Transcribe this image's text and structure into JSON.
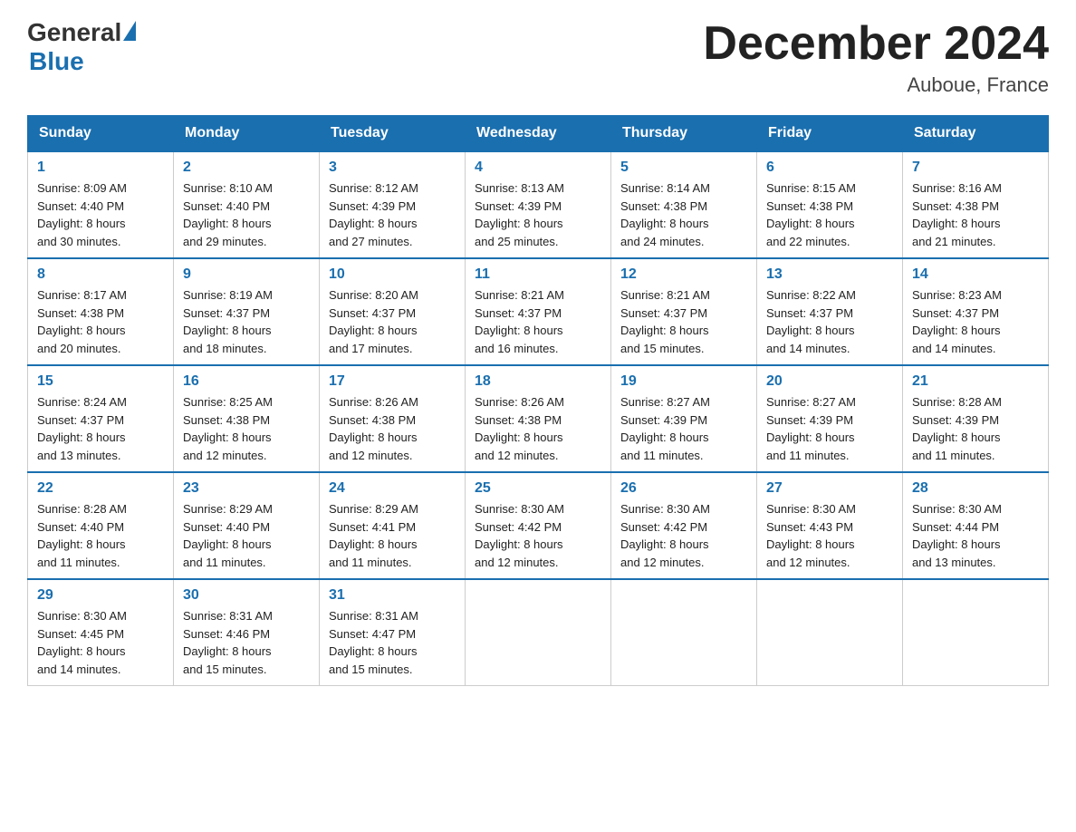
{
  "header": {
    "logo_general": "General",
    "logo_blue": "Blue",
    "month_title": "December 2024",
    "location": "Auboue, France"
  },
  "days_of_week": [
    "Sunday",
    "Monday",
    "Tuesday",
    "Wednesday",
    "Thursday",
    "Friday",
    "Saturday"
  ],
  "weeks": [
    [
      {
        "day": "1",
        "sunrise": "8:09 AM",
        "sunset": "4:40 PM",
        "daylight": "8 hours and 30 minutes."
      },
      {
        "day": "2",
        "sunrise": "8:10 AM",
        "sunset": "4:40 PM",
        "daylight": "8 hours and 29 minutes."
      },
      {
        "day": "3",
        "sunrise": "8:12 AM",
        "sunset": "4:39 PM",
        "daylight": "8 hours and 27 minutes."
      },
      {
        "day": "4",
        "sunrise": "8:13 AM",
        "sunset": "4:39 PM",
        "daylight": "8 hours and 25 minutes."
      },
      {
        "day": "5",
        "sunrise": "8:14 AM",
        "sunset": "4:38 PM",
        "daylight": "8 hours and 24 minutes."
      },
      {
        "day": "6",
        "sunrise": "8:15 AM",
        "sunset": "4:38 PM",
        "daylight": "8 hours and 22 minutes."
      },
      {
        "day": "7",
        "sunrise": "8:16 AM",
        "sunset": "4:38 PM",
        "daylight": "8 hours and 21 minutes."
      }
    ],
    [
      {
        "day": "8",
        "sunrise": "8:17 AM",
        "sunset": "4:38 PM",
        "daylight": "8 hours and 20 minutes."
      },
      {
        "day": "9",
        "sunrise": "8:19 AM",
        "sunset": "4:37 PM",
        "daylight": "8 hours and 18 minutes."
      },
      {
        "day": "10",
        "sunrise": "8:20 AM",
        "sunset": "4:37 PM",
        "daylight": "8 hours and 17 minutes."
      },
      {
        "day": "11",
        "sunrise": "8:21 AM",
        "sunset": "4:37 PM",
        "daylight": "8 hours and 16 minutes."
      },
      {
        "day": "12",
        "sunrise": "8:21 AM",
        "sunset": "4:37 PM",
        "daylight": "8 hours and 15 minutes."
      },
      {
        "day": "13",
        "sunrise": "8:22 AM",
        "sunset": "4:37 PM",
        "daylight": "8 hours and 14 minutes."
      },
      {
        "day": "14",
        "sunrise": "8:23 AM",
        "sunset": "4:37 PM",
        "daylight": "8 hours and 14 minutes."
      }
    ],
    [
      {
        "day": "15",
        "sunrise": "8:24 AM",
        "sunset": "4:37 PM",
        "daylight": "8 hours and 13 minutes."
      },
      {
        "day": "16",
        "sunrise": "8:25 AM",
        "sunset": "4:38 PM",
        "daylight": "8 hours and 12 minutes."
      },
      {
        "day": "17",
        "sunrise": "8:26 AM",
        "sunset": "4:38 PM",
        "daylight": "8 hours and 12 minutes."
      },
      {
        "day": "18",
        "sunrise": "8:26 AM",
        "sunset": "4:38 PM",
        "daylight": "8 hours and 12 minutes."
      },
      {
        "day": "19",
        "sunrise": "8:27 AM",
        "sunset": "4:39 PM",
        "daylight": "8 hours and 11 minutes."
      },
      {
        "day": "20",
        "sunrise": "8:27 AM",
        "sunset": "4:39 PM",
        "daylight": "8 hours and 11 minutes."
      },
      {
        "day": "21",
        "sunrise": "8:28 AM",
        "sunset": "4:39 PM",
        "daylight": "8 hours and 11 minutes."
      }
    ],
    [
      {
        "day": "22",
        "sunrise": "8:28 AM",
        "sunset": "4:40 PM",
        "daylight": "8 hours and 11 minutes."
      },
      {
        "day": "23",
        "sunrise": "8:29 AM",
        "sunset": "4:40 PM",
        "daylight": "8 hours and 11 minutes."
      },
      {
        "day": "24",
        "sunrise": "8:29 AM",
        "sunset": "4:41 PM",
        "daylight": "8 hours and 11 minutes."
      },
      {
        "day": "25",
        "sunrise": "8:30 AM",
        "sunset": "4:42 PM",
        "daylight": "8 hours and 12 minutes."
      },
      {
        "day": "26",
        "sunrise": "8:30 AM",
        "sunset": "4:42 PM",
        "daylight": "8 hours and 12 minutes."
      },
      {
        "day": "27",
        "sunrise": "8:30 AM",
        "sunset": "4:43 PM",
        "daylight": "8 hours and 12 minutes."
      },
      {
        "day": "28",
        "sunrise": "8:30 AM",
        "sunset": "4:44 PM",
        "daylight": "8 hours and 13 minutes."
      }
    ],
    [
      {
        "day": "29",
        "sunrise": "8:30 AM",
        "sunset": "4:45 PM",
        "daylight": "8 hours and 14 minutes."
      },
      {
        "day": "30",
        "sunrise": "8:31 AM",
        "sunset": "4:46 PM",
        "daylight": "8 hours and 15 minutes."
      },
      {
        "day": "31",
        "sunrise": "8:31 AM",
        "sunset": "4:47 PM",
        "daylight": "8 hours and 15 minutes."
      },
      null,
      null,
      null,
      null
    ]
  ],
  "labels": {
    "sunrise": "Sunrise:",
    "sunset": "Sunset:",
    "daylight": "Daylight:"
  }
}
